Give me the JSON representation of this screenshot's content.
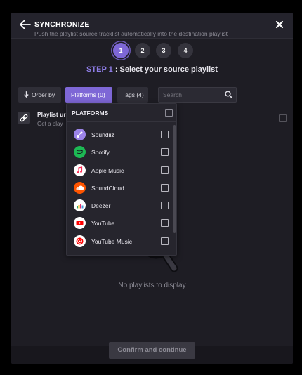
{
  "header": {
    "title": "SYNCHRONIZE",
    "subtitle": "Push the playlist source tracklist automatically into the destination playlist"
  },
  "steps": {
    "items": [
      "1",
      "2",
      "3",
      "4"
    ],
    "active": "1",
    "label_prefix": "STEP 1",
    "label_text": " : Select your source playlist"
  },
  "toolbar": {
    "order_by": "Order by",
    "platforms": "Platforms (0)",
    "tags": "Tags (4)",
    "search_placeholder": "Search"
  },
  "playlist_row": {
    "title": "Playlist ur",
    "subtitle": "Get a play"
  },
  "dropdown": {
    "title": "PLATFORMS",
    "items": [
      {
        "name": "Soundiiz",
        "color": "#9c84e8"
      },
      {
        "name": "Spotify",
        "color": "#1db954"
      },
      {
        "name": "Apple Music",
        "color": "#ffffff"
      },
      {
        "name": "SoundCloud",
        "color": "#ff5500"
      },
      {
        "name": "Deezer",
        "color": "#ffffff"
      },
      {
        "name": "YouTube",
        "color": "#ffffff"
      },
      {
        "name": "YouTube Music",
        "color": "#ffffff"
      }
    ]
  },
  "empty_state": {
    "text": "No playlists to display"
  },
  "footer": {
    "confirm": "Confirm and continue"
  }
}
